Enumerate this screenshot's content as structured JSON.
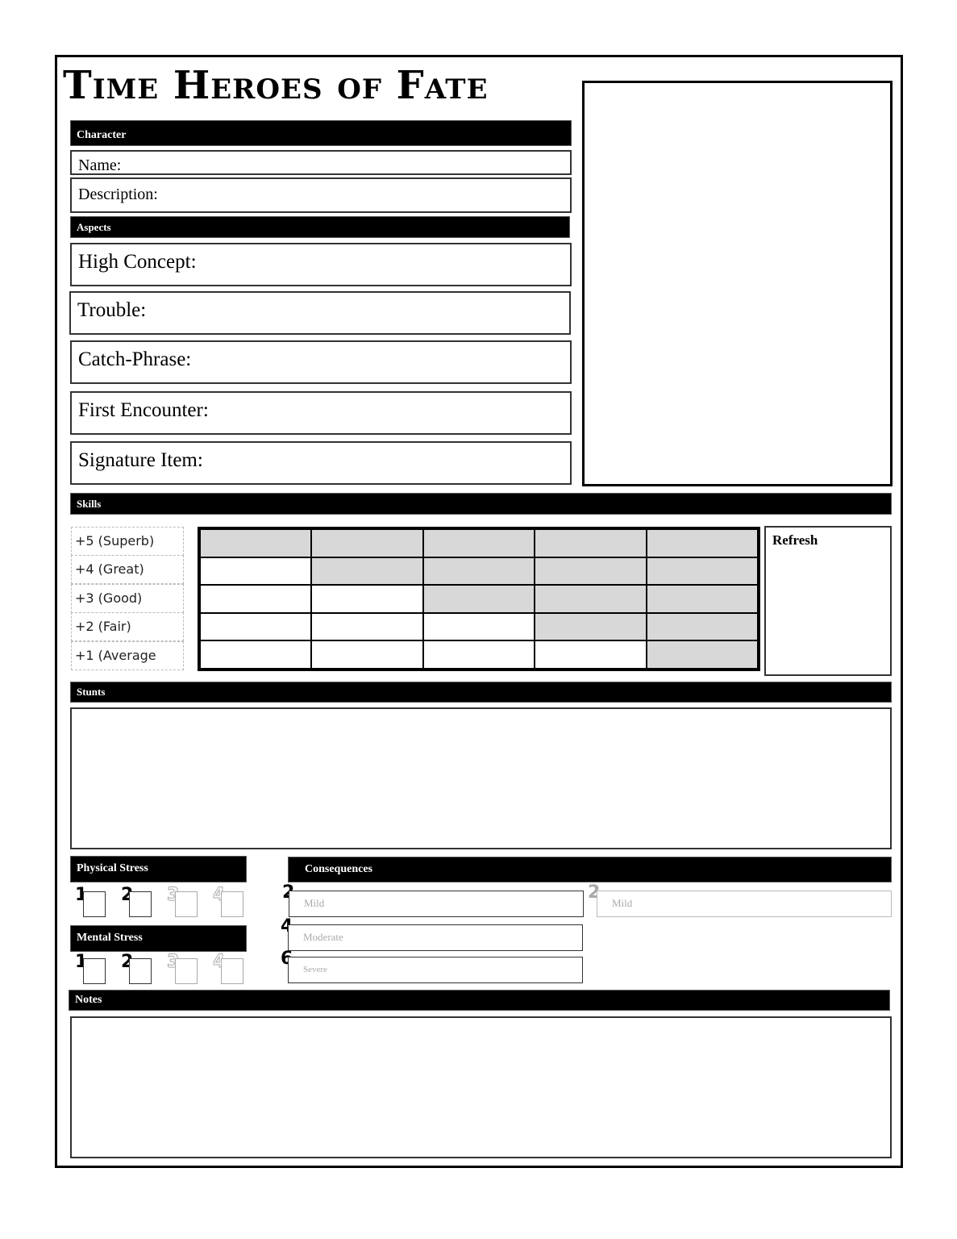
{
  "title": "Time Heroes of Fate",
  "sections": {
    "character": "Character",
    "aspects": "Aspects",
    "skills": "Skills",
    "stunts": "Stunts",
    "physical_stress": "Physical Stress",
    "mental_stress": "Mental Stress",
    "consequences": "Consequences",
    "notes": "Notes"
  },
  "character_fields": {
    "name": "Name:",
    "description": "Description:"
  },
  "aspects": [
    "High Concept:",
    "Trouble:",
    "Catch-Phrase:",
    "First Encounter:",
    "Signature Item:"
  ],
  "skill_levels": [
    "+5 (Superb)",
    "+4 (Great)",
    "+3 (Good)",
    "+2 (Fair)",
    "+1 (Average"
  ],
  "skill_grid": {
    "rows": 5,
    "columns": 5,
    "shading_color": "#d8d8d8"
  },
  "refresh_label": "Refresh",
  "physical_stress_boxes": [
    "1",
    "2",
    "3",
    "4"
  ],
  "mental_stress_boxes": [
    "1",
    "2",
    "3",
    "4"
  ],
  "consequences": [
    {
      "value": "2",
      "label": "Mild"
    },
    {
      "value": "4",
      "label": "Moderate"
    },
    {
      "value": "6",
      "label": "Severe"
    },
    {
      "value": "2",
      "label": "Mild"
    }
  ]
}
